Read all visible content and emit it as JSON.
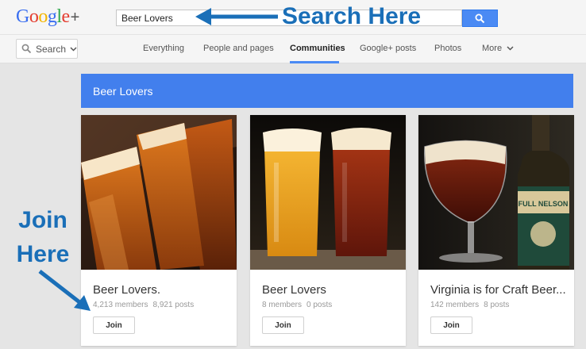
{
  "header": {
    "logo_text": "Google+",
    "search_value": "Beer Lovers"
  },
  "nav": {
    "search_label": "Search",
    "tabs": [
      {
        "label": "Everything",
        "active": false
      },
      {
        "label": "People and pages",
        "active": false
      },
      {
        "label": "Communities",
        "active": true
      },
      {
        "label": "Google+ posts",
        "active": false
      },
      {
        "label": "Photos",
        "active": false
      },
      {
        "label": "More",
        "active": false
      }
    ]
  },
  "results": {
    "heading": "Beer Lovers",
    "cards": [
      {
        "title": "Beer Lovers.",
        "members": "4,213 members",
        "posts": "8,921 posts",
        "join_label": "Join"
      },
      {
        "title": "Beer Lovers",
        "members": "8 members",
        "posts": "0 posts",
        "join_label": "Join"
      },
      {
        "title": "Virginia is for Craft Beer...",
        "members": "142 members",
        "posts": "8 posts",
        "join_label": "Join"
      }
    ],
    "bottle_label": "FULL NELSON"
  },
  "annotations": {
    "search_here": "Search Here",
    "join_line1": "Join",
    "join_line2": "Here"
  },
  "colors": {
    "accent": "#4a8af4",
    "header_band": "#427fed",
    "annotation": "#1a6fb8"
  }
}
